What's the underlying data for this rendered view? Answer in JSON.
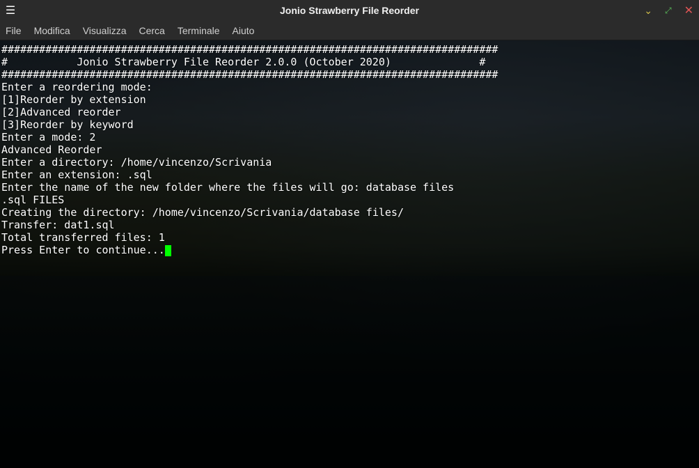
{
  "window": {
    "title": "Jonio Strawberry File Reorder"
  },
  "menu": {
    "file": "File",
    "edit": "Modifica",
    "view": "Visualizza",
    "search": "Cerca",
    "terminal": "Terminale",
    "help": "Aiuto"
  },
  "terminal_lines": [
    "###############################################################################",
    "#           Jonio Strawberry File Reorder 2.0.0 (October 2020)              #",
    "###############################################################################",
    "Enter a reordering mode:",
    "[1]Reorder by extension",
    "[2]Advanced reorder",
    "[3]Reorder by keyword",
    "Enter a mode: 2",
    "Advanced Reorder",
    "Enter a directory: /home/vincenzo/Scrivania",
    "Enter an extension: .sql",
    "Enter the name of the new folder where the files will go: database files",
    ".sql FILES",
    "Creating the directory: /home/vincenzo/Scrivania/database files/",
    "Transfer: dat1.sql",
    "Total transferred files: 1",
    "Press Enter to continue..."
  ]
}
